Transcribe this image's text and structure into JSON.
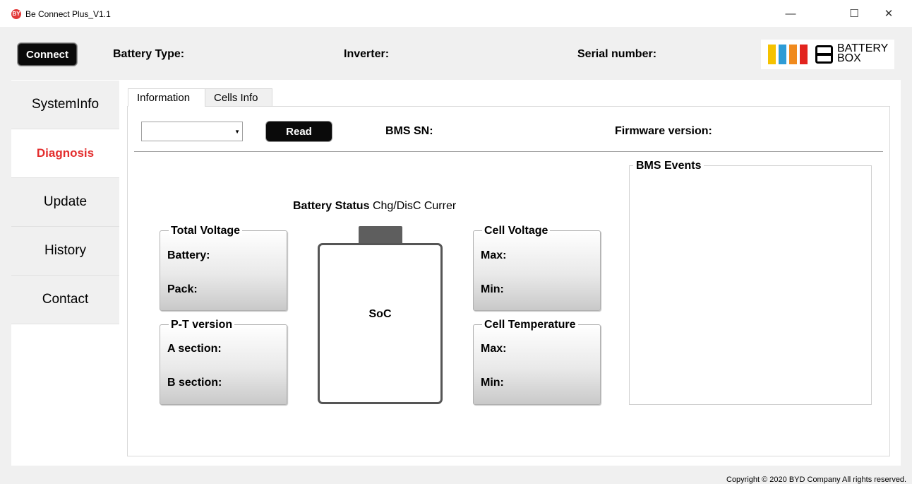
{
  "window": {
    "title": "Be Connect Plus_V1.1",
    "minimize_glyph": "—",
    "maximize_glyph": "☐",
    "close_glyph": "✕",
    "app_icon_text": "BY"
  },
  "header": {
    "connect_label": "Connect",
    "battery_type_label": "Battery Type:",
    "inverter_label": "Inverter:",
    "serial_number_label": "Serial number:",
    "logo": {
      "line1": "BATTERY",
      "line2": "BOX",
      "colors": [
        "#f5c200",
        "#2e9cd6",
        "#f08a1e",
        "#e2241e"
      ]
    }
  },
  "sidebar": {
    "items": [
      {
        "label": "SystemInfo",
        "active": false
      },
      {
        "label": "Diagnosis",
        "active": true
      },
      {
        "label": "Update",
        "active": false
      },
      {
        "label": "History",
        "active": false
      },
      {
        "label": "Contact",
        "active": false
      }
    ],
    "active_color": "#e32d2d"
  },
  "tabs": [
    {
      "label": "Information",
      "active": true
    },
    {
      "label": "Cells Info",
      "active": false
    }
  ],
  "toolbar": {
    "dropdown_value": "",
    "read_label": "Read",
    "bms_sn_label": "BMS SN:",
    "firmware_label": "Firmware version:"
  },
  "battery_status": {
    "title": "Battery Status",
    "subtitle": "Chg/DisC Currer",
    "soc_label": "SoC"
  },
  "total_voltage": {
    "title": "Total Voltage",
    "battery": "Battery:",
    "pack": "Pack:"
  },
  "pt_version": {
    "title": "P-T version",
    "a_section": "A section:",
    "b_section": "B section:"
  },
  "cell_voltage": {
    "title": "Cell Voltage",
    "max": "Max:",
    "min": "Min:"
  },
  "cell_temperature": {
    "title": "Cell Temperature",
    "max": "Max:",
    "min": "Min:"
  },
  "bms_events": {
    "title": "BMS Events"
  },
  "footer": {
    "copyright": "Copyright © 2020 BYD Company All rights reserved."
  }
}
